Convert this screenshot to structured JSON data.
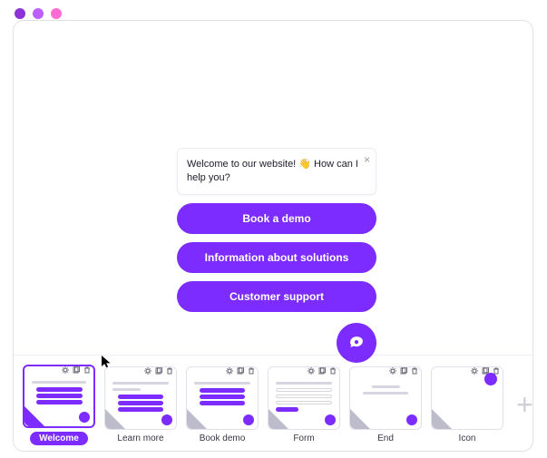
{
  "colors": {
    "accent": "#7c2cff"
  },
  "chat": {
    "greeting_prefix": "Welcome to our website! ",
    "greeting_emoji": "👋",
    "greeting_suffix": "  How can I help you?",
    "close_glyph": "×",
    "buttons": [
      {
        "label": "Book a demo"
      },
      {
        "label": "Information about solutions"
      },
      {
        "label": "Customer support"
      }
    ]
  },
  "thumbnails": [
    {
      "id": "welcome",
      "label": "Welcome",
      "active": true
    },
    {
      "id": "learnmore",
      "label": "Learn more",
      "active": false
    },
    {
      "id": "bookdemo",
      "label": "Book demo",
      "active": false
    },
    {
      "id": "form",
      "label": "Form",
      "active": false
    },
    {
      "id": "end",
      "label": "End",
      "active": false
    },
    {
      "id": "icon",
      "label": "Icon",
      "active": false
    }
  ],
  "add_slide_label": "+"
}
